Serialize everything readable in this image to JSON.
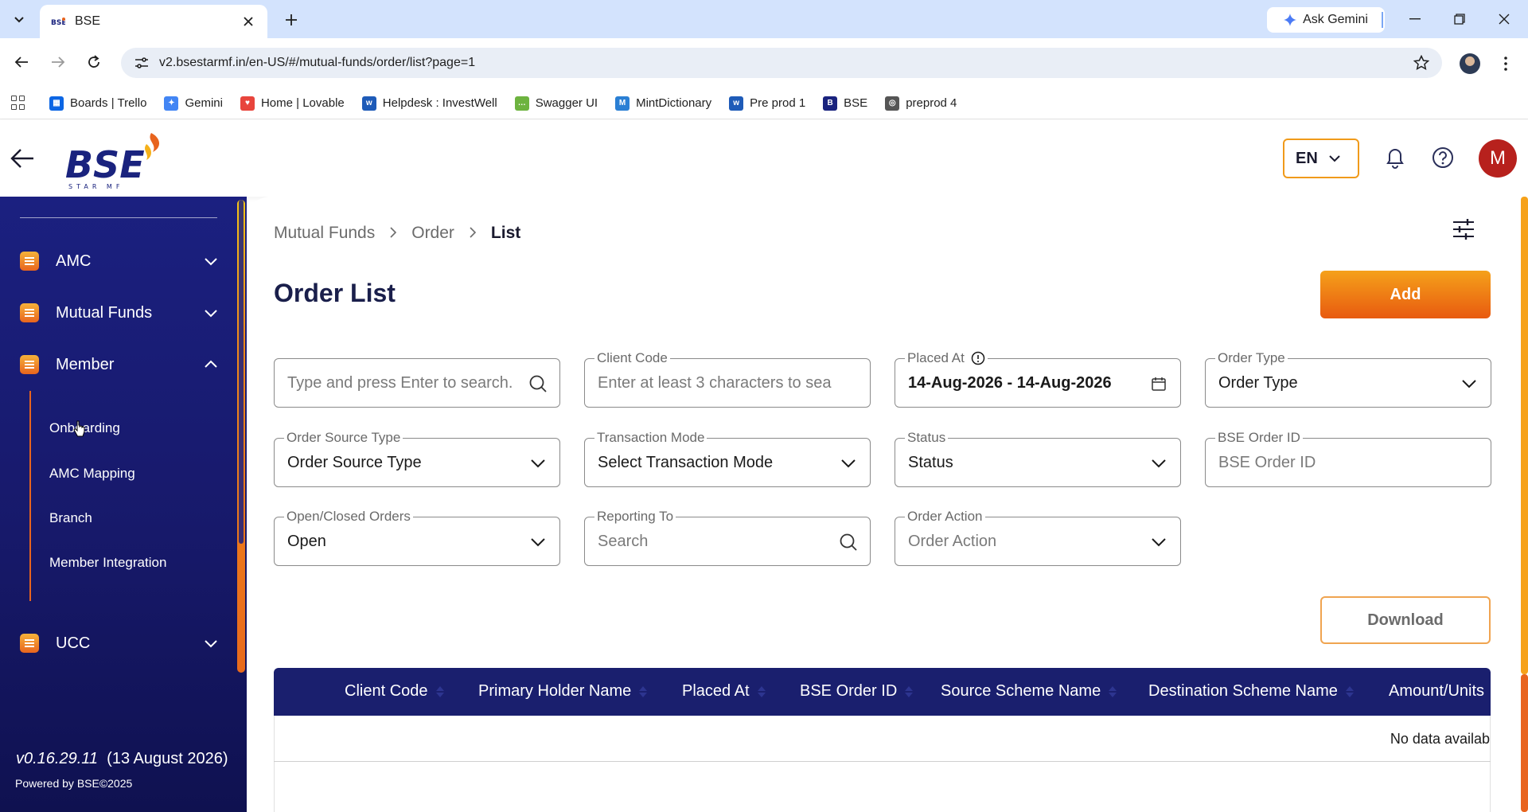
{
  "browser": {
    "tab_title": "BSE",
    "url": "v2.bsestarmf.in/en-US/#/mutual-funds/order/list?page=1",
    "gemini_label": "Ask Gemini",
    "bookmarks": [
      {
        "label": "Boards | Trello",
        "icon": "trello-icon",
        "color": "#0c66e4"
      },
      {
        "label": "Gemini",
        "icon": "gemini-icon",
        "color": "#4285f4"
      },
      {
        "label": "Home | Lovable",
        "icon": "lovable-icon",
        "color": "#e8453c"
      },
      {
        "label": "Helpdesk : InvestWell",
        "icon": "investwell-icon",
        "color": "#1e5bb8"
      },
      {
        "label": "Swagger UI",
        "icon": "swagger-icon",
        "color": "#6db33f"
      },
      {
        "label": "MintDictionary",
        "icon": "mintdictionary-icon",
        "color": "#2a7fd4"
      },
      {
        "label": "Pre prod 1",
        "icon": "investwell-icon",
        "color": "#1e5bb8"
      },
      {
        "label": "BSE",
        "icon": "bse-icon",
        "color": "#1a237e"
      },
      {
        "label": "preprod 4",
        "icon": "globe-icon",
        "color": "#555555"
      }
    ]
  },
  "header": {
    "logo_text": "BSE",
    "logo_sub": "STAR MF",
    "language": "EN",
    "avatar_initial": "M"
  },
  "sidebar": {
    "items": [
      {
        "label": "AMC",
        "expanded": false
      },
      {
        "label": "Mutual Funds",
        "expanded": false
      },
      {
        "label": "Member",
        "expanded": true
      },
      {
        "label": "UCC",
        "expanded": false
      }
    ],
    "member_submenu": [
      "Onboarding",
      "AMC Mapping",
      "Branch",
      "Member Integration"
    ],
    "version": "v0.16.29.11",
    "version_date": "(13 August 2026)",
    "powered_by": "Powered by BSE©2025"
  },
  "breadcrumb": {
    "items": [
      "Mutual Funds",
      "Order",
      "List"
    ]
  },
  "page": {
    "title": "Order List",
    "add_label": "Add",
    "download_label": "Download"
  },
  "filters": {
    "search": {
      "placeholder": "Type and press Enter to search."
    },
    "client_code": {
      "label": "Client Code",
      "placeholder": "Enter at least 3 characters to sea"
    },
    "placed_at": {
      "label": "Placed At",
      "value": "14-Aug-2026 - 14-Aug-2026"
    },
    "order_type": {
      "label": "Order Type",
      "value": "Order Type"
    },
    "order_source_type": {
      "label": "Order Source Type",
      "value": "Order Source Type"
    },
    "transaction_mode": {
      "label": "Transaction Mode",
      "value": "Select Transaction Mode"
    },
    "status": {
      "label": "Status",
      "value": "Status"
    },
    "bse_order_id": {
      "label": "BSE Order ID",
      "placeholder": "BSE Order ID"
    },
    "open_closed": {
      "label": "Open/Closed Orders",
      "value": "Open"
    },
    "reporting_to": {
      "label": "Reporting To",
      "placeholder": "Search"
    },
    "order_action": {
      "label": "Order Action",
      "placeholder": "Order Action"
    }
  },
  "table": {
    "columns": [
      "Client Code",
      "Primary Holder Name",
      "Placed At",
      "BSE Order ID",
      "Source Scheme Name",
      "Destination Scheme Name",
      "Amount/Units"
    ],
    "empty_text": "No data availab"
  },
  "colors": {
    "accent_orange": "#e8641e",
    "sidebar_navy": "#1b2080",
    "table_header": "#1a1f6e",
    "avatar_red": "#b7211d"
  }
}
